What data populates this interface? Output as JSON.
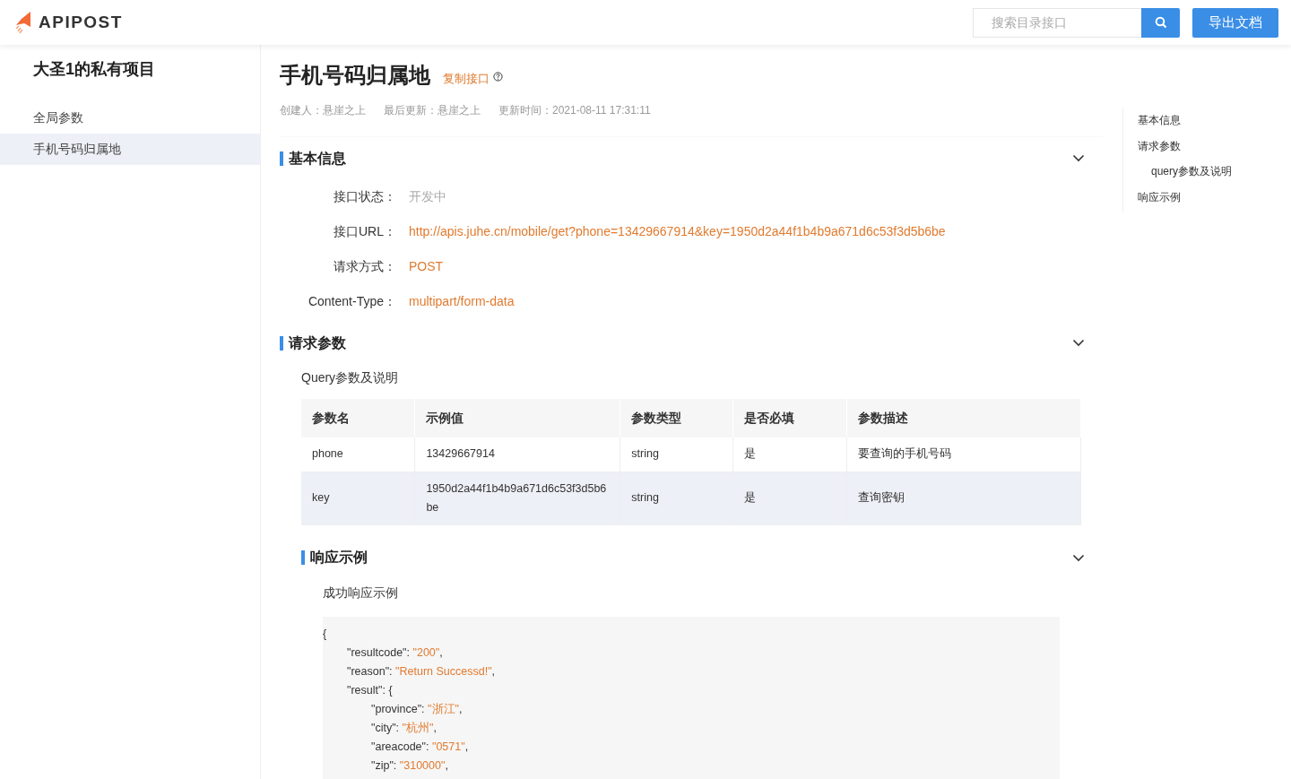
{
  "header": {
    "logo": "APIPOST",
    "search": {
      "placeholder": "搜索目录接口"
    },
    "export_button": "导出文档"
  },
  "sidebar": {
    "project": "大圣1的私有项目",
    "items": [
      {
        "label": "全局参数",
        "selected": false
      },
      {
        "label": "手机号码归属地",
        "selected": true
      }
    ]
  },
  "page": {
    "title": "手机号码归属地",
    "copy_link": "复制接口",
    "meta": [
      "创建人：悬崖之上",
      "最后更新：悬崖之上",
      "更新时间：2021-08-11 17:31:11"
    ]
  },
  "basic_info": {
    "heading": "基本信息",
    "expanded": true,
    "fields": [
      {
        "label": "接口状态：",
        "value": "开发中",
        "kind": "status"
      },
      {
        "label": "接口URL：",
        "value": "http://apis.juhe.cn/mobile/get?phone=13429667914&key=1950d2a44f1b4b9a671d6c53f3d5b6be",
        "kind": "link"
      },
      {
        "label": "请求方式：",
        "value": "POST",
        "kind": "link"
      },
      {
        "label": "Content-Type：",
        "value": "multipart/form-data",
        "kind": "link"
      }
    ]
  },
  "request_params": {
    "heading": "请求参数",
    "expanded": true,
    "subheading": "Query参数及说明",
    "table": {
      "columns": [
        "参数名",
        "示例值",
        "参数类型",
        "是否必填",
        "参数描述"
      ],
      "rows": [
        {
          "cells": [
            "phone",
            "13429667914",
            "string",
            "是",
            "要查询的手机号码"
          ],
          "selected": false
        },
        {
          "cells": [
            "key",
            "1950d2a44f1b4b9a671d6c53f3d5b6be",
            "string",
            "是",
            "查询密钥"
          ],
          "selected": true
        }
      ]
    }
  },
  "response": {
    "heading": "响应示例",
    "expanded": true,
    "subheading": "成功响应示例",
    "code": {
      "open": "{",
      "entries": [
        {
          "key": "\"resultcode\": ",
          "value": "\"200\"",
          "tail": ","
        },
        {
          "key": "\"reason\": ",
          "value": "\"Return Successd!\"",
          "tail": ","
        },
        {
          "key": "\"result\": ",
          "tail": "{",
          "children": [
            {
              "key": "\"province\": ",
              "value": "\"浙江\"",
              "tail": ","
            },
            {
              "key": "\"city\": ",
              "value": "\"杭州\"",
              "tail": ","
            },
            {
              "key": "\"areacode\": ",
              "value": "\"0571\"",
              "tail": ","
            },
            {
              "key": "\"zip\": ",
              "value": "\"310000\"",
              "tail": ","
            }
          ]
        }
      ]
    }
  },
  "outline": [
    {
      "label": "基本信息"
    },
    {
      "label": "请求参数",
      "children": [
        {
          "label": "query参数及说明"
        }
      ]
    },
    {
      "label": "响应示例"
    }
  ]
}
